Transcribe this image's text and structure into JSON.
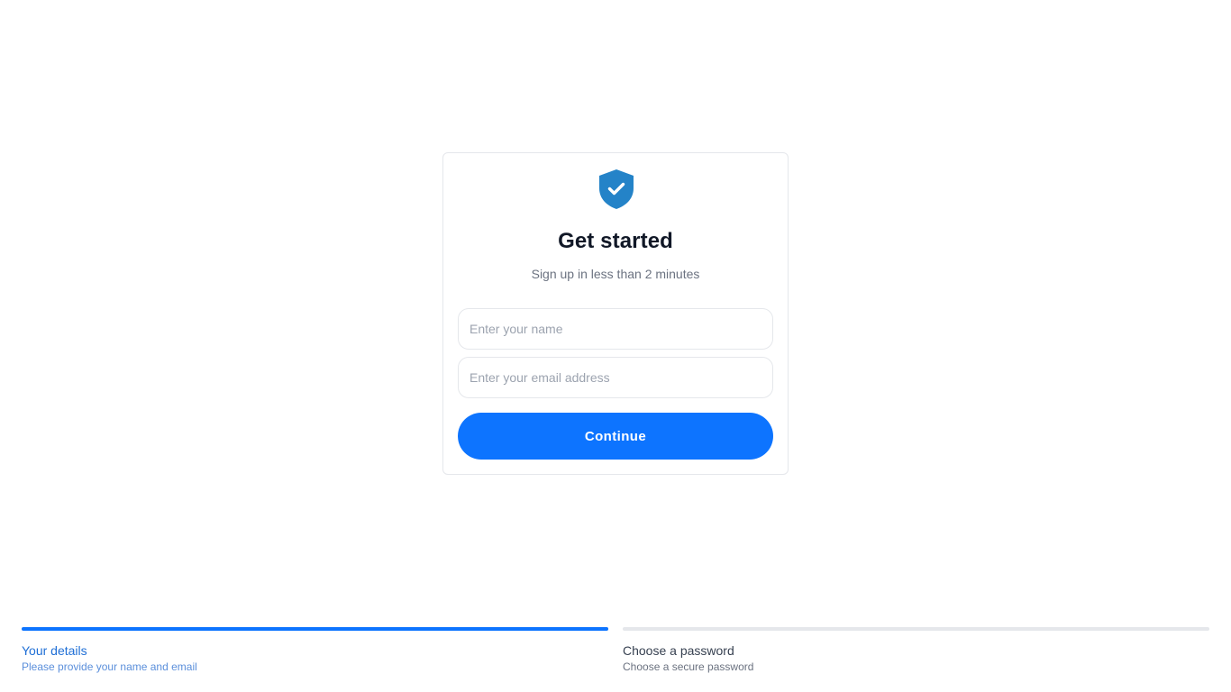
{
  "colors": {
    "accent": "#0d74ff",
    "shield": "#2483c8",
    "text_primary": "#111827",
    "text_muted": "#6b7280",
    "border": "#e5e7eb",
    "track": "#e5e7eb"
  },
  "card": {
    "icon": "shield-check-icon",
    "title": "Get started",
    "subtitle": "Sign up in less than 2 minutes",
    "name_field": {
      "value": "",
      "placeholder": "Enter your name"
    },
    "email_field": {
      "value": "",
      "placeholder": "Enter your email address"
    },
    "continue_label": "Continue"
  },
  "steps": [
    {
      "title": "Your details",
      "description": "Please provide your name and email",
      "progress": 1.0,
      "active": true
    },
    {
      "title": "Choose a password",
      "description": "Choose a secure password",
      "progress": 0.0,
      "active": false
    }
  ]
}
